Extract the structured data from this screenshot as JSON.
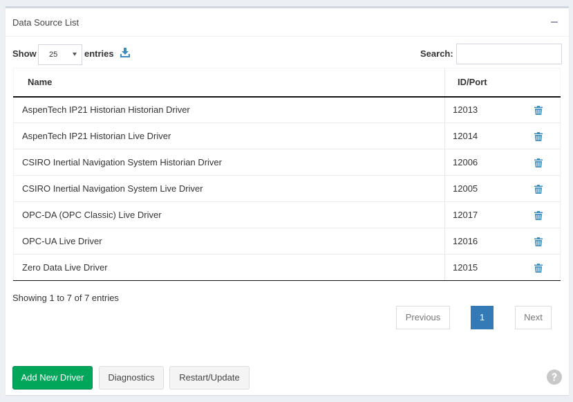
{
  "panel": {
    "title": "Data Source List"
  },
  "length": {
    "show_label": "Show",
    "selected": "25",
    "entries_label": "entries"
  },
  "search": {
    "label": "Search:",
    "value": "",
    "placeholder": ""
  },
  "table": {
    "columns": [
      "Name",
      "ID/Port"
    ],
    "rows": [
      {
        "name": "AspenTech IP21 Historian Historian Driver",
        "id": "12013"
      },
      {
        "name": "AspenTech IP21 Historian Live Driver",
        "id": "12014"
      },
      {
        "name": "CSIRO Inertial Navigation System Historian Driver",
        "id": "12006"
      },
      {
        "name": "CSIRO Inertial Navigation System Live Driver",
        "id": "12005"
      },
      {
        "name": "OPC-DA (OPC Classic) Live Driver",
        "id": "12017"
      },
      {
        "name": "OPC-UA Live Driver",
        "id": "12016"
      },
      {
        "name": "Zero Data Live Driver",
        "id": "12015"
      }
    ]
  },
  "info": "Showing 1 to 7 of 7 entries",
  "pagination": {
    "previous": "Previous",
    "current": "1",
    "next": "Next"
  },
  "buttons": {
    "add": "Add New Driver",
    "diagnostics": "Diagnostics",
    "restart": "Restart/Update"
  },
  "icons": {
    "download": "download-icon",
    "delete": "trash-icon",
    "help": "question-circle-icon",
    "collapse": "minus-icon"
  },
  "colors": {
    "primary": "#337ab7",
    "success": "#00a65a",
    "icon_blue": "#3c8dbc",
    "help_gray": "#c8c8c8"
  }
}
